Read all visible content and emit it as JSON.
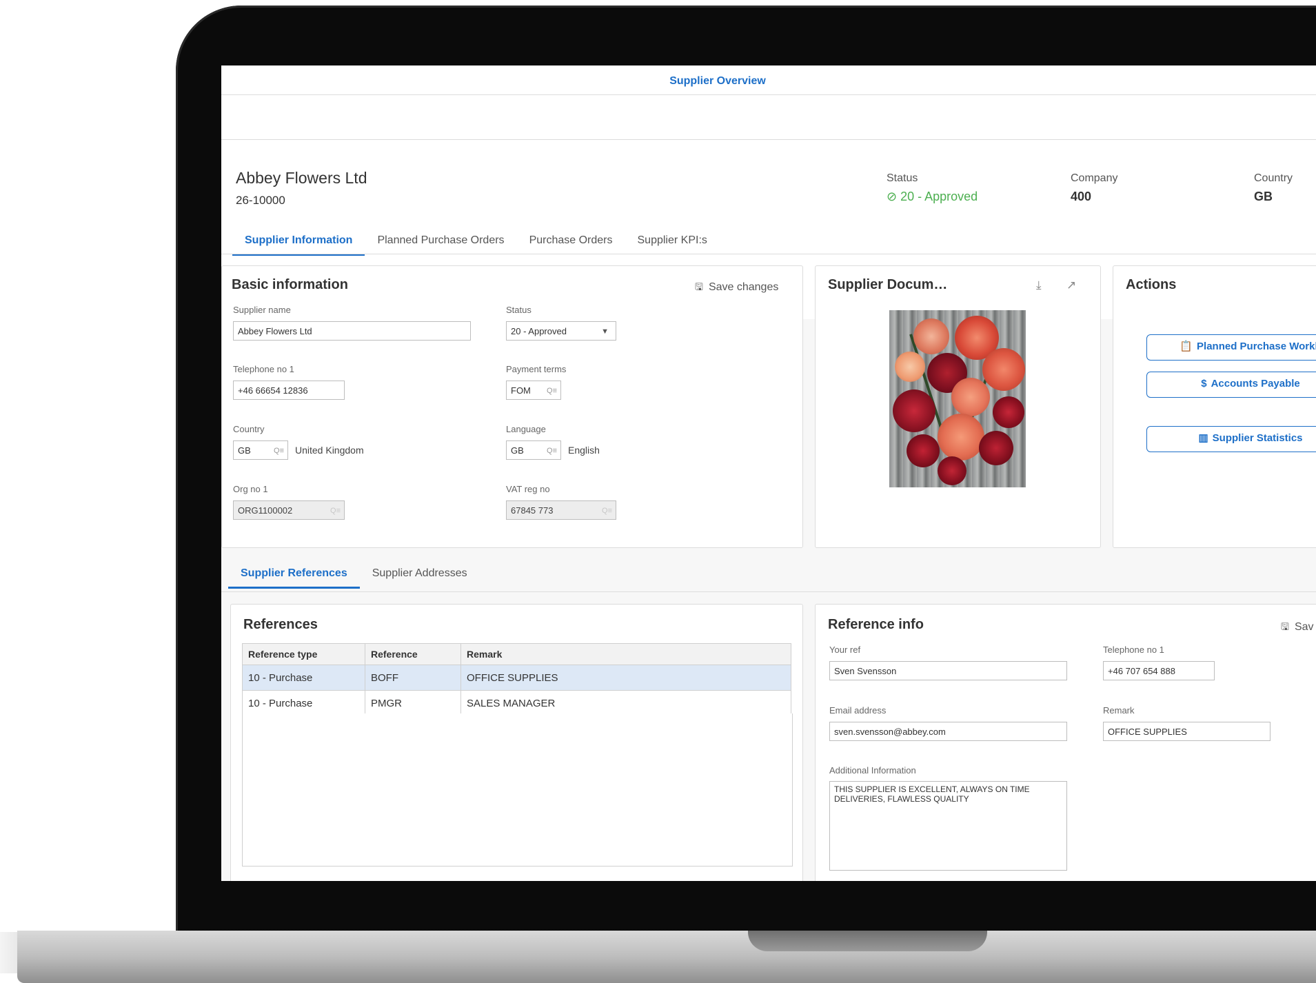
{
  "app": {
    "title": "Supplier Overview"
  },
  "supplier": {
    "name": "Abbey Flowers Ltd",
    "id": "26-10000",
    "status_label": "Status",
    "status_value": "20 - Approved",
    "company_label": "Company",
    "company_value": "400",
    "country_label": "Country",
    "country_value": "GB"
  },
  "tabs": [
    {
      "label": "Supplier Information",
      "active": true
    },
    {
      "label": "Planned Purchase Orders"
    },
    {
      "label": "Purchase Orders"
    },
    {
      "label": "Supplier KPI:s"
    }
  ],
  "basic": {
    "title": "Basic information",
    "save_label": "Save changes",
    "supplier_name_label": "Supplier name",
    "supplier_name_value": "Abbey Flowers Ltd",
    "status_label": "Status",
    "status_value": "20 - Approved",
    "telephone_label": "Telephone no 1",
    "telephone_value": "+46 66654 12836",
    "payment_label": "Payment terms",
    "payment_value": "FOM",
    "country_label": "Country",
    "country_value": "GB",
    "country_name": "United Kingdom",
    "language_label": "Language",
    "language_value": "GB",
    "language_name": "English",
    "org_label": "Org no 1",
    "org_value": "ORG1100002",
    "vat_label": "VAT reg no",
    "vat_value": "67845 773"
  },
  "documents": {
    "title": "Supplier Docum…"
  },
  "actions": {
    "title": "Actions",
    "buttons": [
      {
        "label": "Planned Purchase Workb",
        "icon": "clipboard-icon"
      },
      {
        "label": "Accounts Payable",
        "icon": "dollar-icon"
      },
      {
        "label": "Supplier Statistics",
        "icon": "chart-icon"
      }
    ]
  },
  "subtabs": [
    {
      "label": "Supplier References",
      "active": true
    },
    {
      "label": "Supplier Addresses"
    }
  ],
  "references": {
    "title": "References",
    "columns": [
      "Reference type",
      "Reference",
      "Remark"
    ],
    "rows": [
      [
        "10 - Purchase",
        "BOFF",
        "OFFICE SUPPLIES"
      ],
      [
        "10 - Purchase",
        "PMGR",
        "SALES MANAGER"
      ]
    ]
  },
  "refinfo": {
    "title": "Reference info",
    "save_label": "Sav",
    "your_ref_label": "Your ref",
    "your_ref_value": "Sven Svensson",
    "tel_label": "Telephone no 1",
    "tel_value": "+46 707 654 888",
    "email_label": "Email address",
    "email_value": "sven.svensson@abbey.com",
    "remark_label": "Remark",
    "remark_value": "OFFICE SUPPLIES",
    "addinfo_label": "Additional Information",
    "addinfo_value": "THIS SUPPLIER IS EXCELLENT, ALWAYS ON TIME DELIVERIES, FLAWLESS QUALITY"
  }
}
